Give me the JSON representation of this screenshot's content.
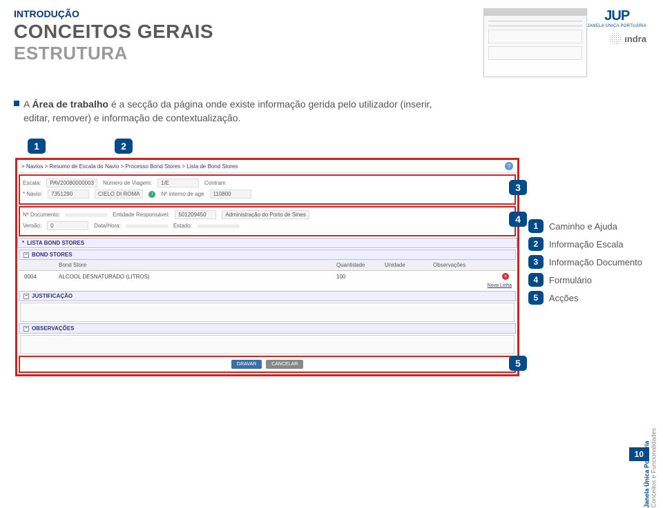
{
  "header": {
    "intro": "INTRODUÇÃO",
    "title": "CONCEITOS GERAIS",
    "subtitle": "ESTRUTURA"
  },
  "logos": {
    "jup_text": "JUP",
    "jup_sub": "JANELA ÚNICA PORTUÁRIA",
    "indra_text": "ındra"
  },
  "body": {
    "bullet_text_prefix": "A ",
    "bullet_bold": "Área de trabalho",
    "bullet_text_suffix": " é a secção da página onde existe informação gerida pelo utilizador (inserir, editar, remover) e informação de contextualização."
  },
  "callouts": {
    "n1": "1",
    "n2": "2",
    "n3": "3",
    "n4": "4",
    "n5": "5"
  },
  "screenshot": {
    "breadcrumb": "> Navios > Resumo de Escala do Navio > Processo Bond Stores > Lista de Bond Stores",
    "help": "?",
    "escala": {
      "escala_lbl": "Escala:",
      "escala_val": "PAV20080000003",
      "nviagem_lbl": "Número de Viagem:",
      "nviagem_val": "1/E",
      "contram_lbl": "Contram",
      "navio_lbl": "* Navio:",
      "navio_val": "7351290",
      "navio_name": "CIELO DI ROMA",
      "ninterno_lbl": "Nº interno de age",
      "ninterno_val": "110800"
    },
    "doc": {
      "ndoc_lbl": "Nº Documento:",
      "ent_lbl": "Entidade Responsável:",
      "ent_val": "501209450",
      "ent_name": "Administração do Porto de Sines",
      "versao_lbl": "Versão:",
      "versao_val": "0",
      "data_lbl": "Data/Hora:",
      "estado_lbl": "Estado:"
    },
    "lista_title": "LISTA BOND STORES",
    "bond_title": "BOND STORES",
    "table": {
      "h_code": "",
      "h_bond": "Bond Store",
      "h_qty": "Quantidade",
      "h_unit": "Unidade",
      "h_obs": "Observações",
      "row_code": "0004",
      "row_desc": "ALCOOL DESNATURADO (LITROS)",
      "row_qty": "100",
      "nova_linha": "Nova Linha"
    },
    "just_title": "JUSTIFICAÇÃO",
    "obs_title": "OBSERVAÇÕES",
    "actions": {
      "gravar": "GRAVAR",
      "cancelar": "CANCELAR"
    }
  },
  "legend": {
    "i1": "Caminho e Ajuda",
    "i2": "Informação Escala",
    "i3": "Informação Documento",
    "i4": "Formulário",
    "i5": "Acções"
  },
  "side": {
    "bold": "Janela Única Portuária",
    "sub": "Conceitos e Funcionalidades"
  },
  "page_number": "10"
}
